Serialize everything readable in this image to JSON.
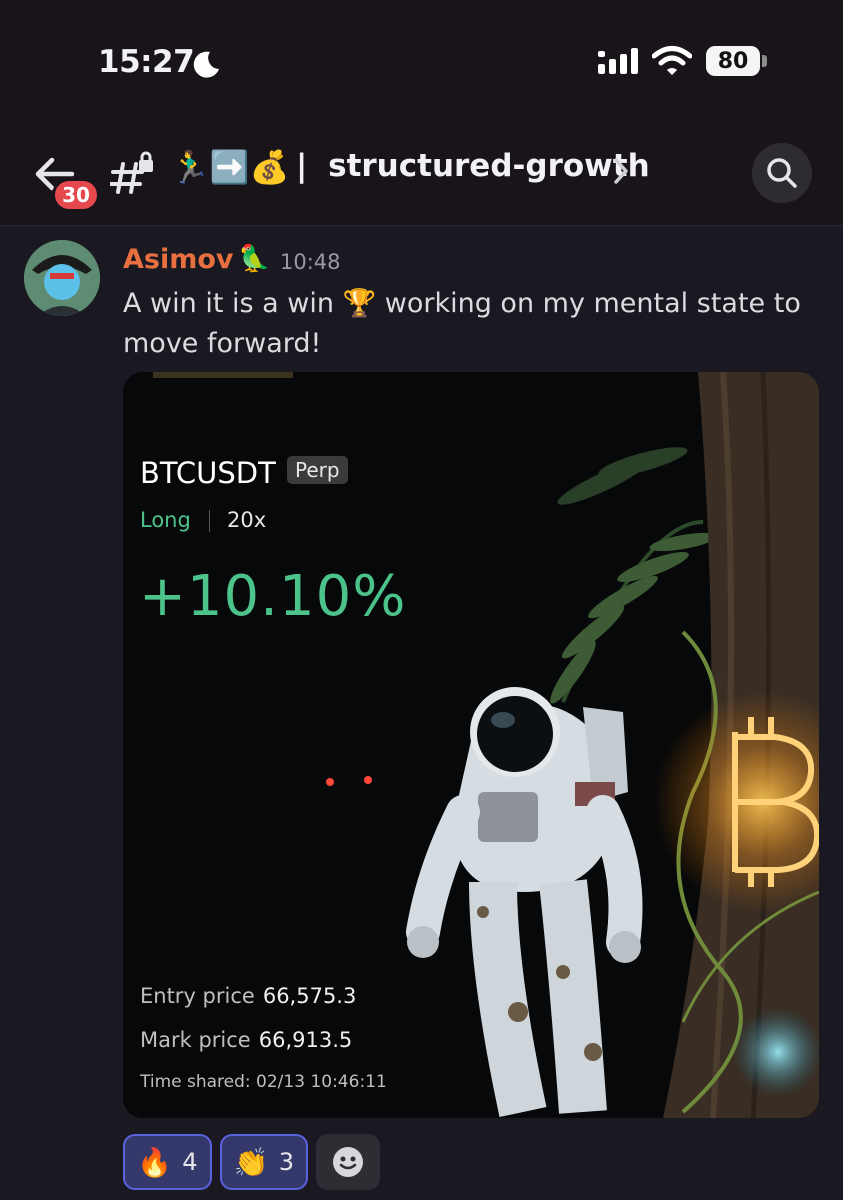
{
  "status_bar": {
    "time": "15:27",
    "battery": "80"
  },
  "header": {
    "unread_count": "30",
    "channel_emoji": "🏃‍♂️➡️💰",
    "channel_separator": "|",
    "channel_name": "structured-growth"
  },
  "message": {
    "author": "Asimov",
    "role_icon": "🦜",
    "time": "10:48",
    "text": "A win it is a win 🏆 working on my mental state to move forward!"
  },
  "trade_card": {
    "pair": "BTCUSDT",
    "contract_type": "Perp",
    "side": "Long",
    "leverage": "20x",
    "pnl_percent": "+10.10%",
    "entry_price_label": "Entry price",
    "entry_price": "66,575.3",
    "mark_price_label": "Mark price",
    "mark_price": "66,913.5",
    "time_shared": "Time shared: 02/13 10:46:11",
    "accent_green": "#4cc38a"
  },
  "reactions": [
    {
      "emoji": "🔥",
      "count": "4"
    },
    {
      "emoji": "👏",
      "count": "3"
    }
  ],
  "colors": {
    "background": "#1a1820",
    "author": "#e87040",
    "badge": "#e5484d",
    "reaction_active": "#34386a"
  }
}
